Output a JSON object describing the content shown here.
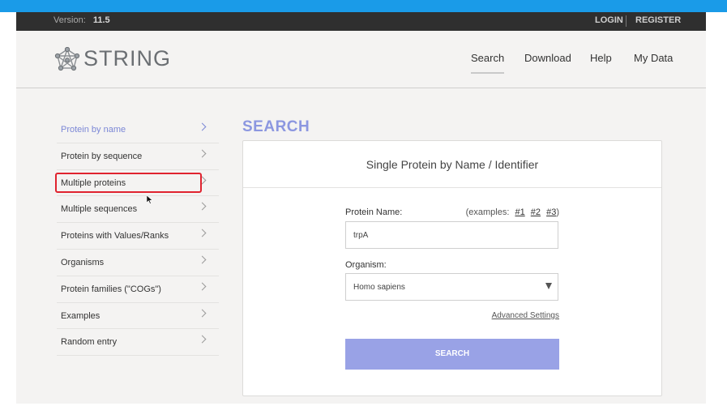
{
  "colors": {
    "accent": "#8c97e0",
    "button": "#99a2e6",
    "highlight": "#e0232f",
    "topbar": "#2f2f2f",
    "strip": "#1a9be8"
  },
  "topbar": {
    "version_label": "Version:",
    "version_value": "11.5",
    "login": "LOGIN",
    "register": "REGISTER"
  },
  "header": {
    "logo_text": "STRING",
    "nav": [
      "Search",
      "Download",
      "Help",
      "My Data"
    ],
    "active_nav": "Search"
  },
  "sidebar": {
    "items": [
      {
        "label": "Protein by name",
        "active": true
      },
      {
        "label": "Protein by sequence"
      },
      {
        "label": "Multiple proteins",
        "highlighted": true
      },
      {
        "label": "Multiple sequences"
      },
      {
        "label": "Proteins with Values/Ranks"
      },
      {
        "label": "Organisms"
      },
      {
        "label": "Protein families (\"COGs\")"
      },
      {
        "label": "Examples"
      },
      {
        "label": "Random entry"
      }
    ]
  },
  "main": {
    "title": "SEARCH",
    "card_title": "Single Protein by Name / Identifier",
    "protein_label": "Protein Name:",
    "examples_prefix": "(examples:",
    "examples": [
      "#1",
      "#2",
      "#3"
    ],
    "examples_suffix": ")",
    "protein_value": "trpA",
    "organism_label": "Organism:",
    "organism_value": "Homo sapiens",
    "advanced": "Advanced Settings",
    "search_button": "SEARCH"
  }
}
